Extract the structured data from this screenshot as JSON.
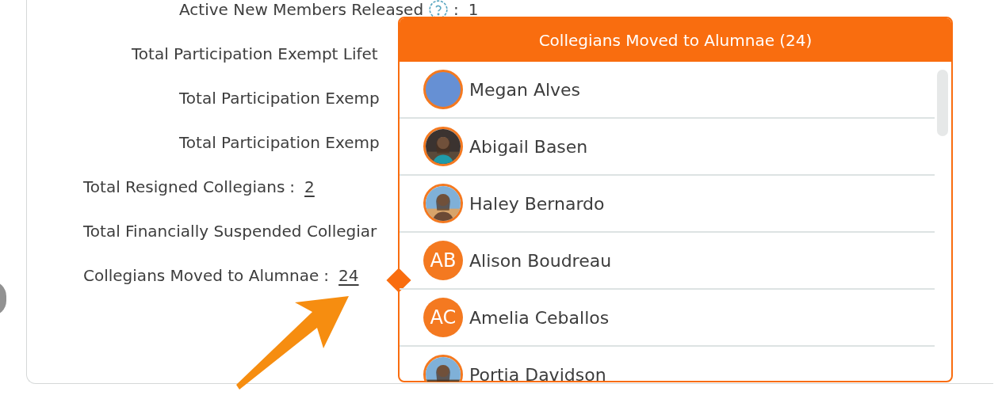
{
  "stats": [
    {
      "children": [
        {
          "children": [
            {
              "label": "Active New Members Released",
              "help": true,
              "separator": ":",
              "value": "1"
            }
          ]
        },
        {
          "label": "Total Participation Exempt Lifet",
          "help": false,
          "children": [
            {
              "label": "Total Participation Exemp",
              "help": false
            },
            {
              "label": "Total Participation Exemp",
              "help": false
            }
          ]
        }
      ]
    },
    {
      "label": "Total Resigned Collegians",
      "help": false,
      "separator": ":",
      "value": "2",
      "link": true
    },
    {
      "label": "Total Financially Suspended Collegiar",
      "help": false
    },
    {
      "label": "Collegians Moved to Alumnae",
      "help": false,
      "separator": ":",
      "value": "24",
      "link": true
    }
  ],
  "popover": {
    "title": "Collegians Moved to Alumnae (24)",
    "members": [
      {
        "name": "Megan Alves",
        "avatar": {
          "kind": "blank"
        }
      },
      {
        "name": "Abigail Basen"
      },
      {
        "name": "Haley Bernardo"
      },
      {
        "name": "Alison Boudreau",
        "avatar": {
          "kind": "initials",
          "initials": "AB"
        }
      },
      {
        "name": "Amelia Ceballos",
        "avatar": {
          "kind": "initials",
          "initials": "AC"
        }
      },
      {
        "name": "Portia Davidson"
      }
    ]
  }
}
